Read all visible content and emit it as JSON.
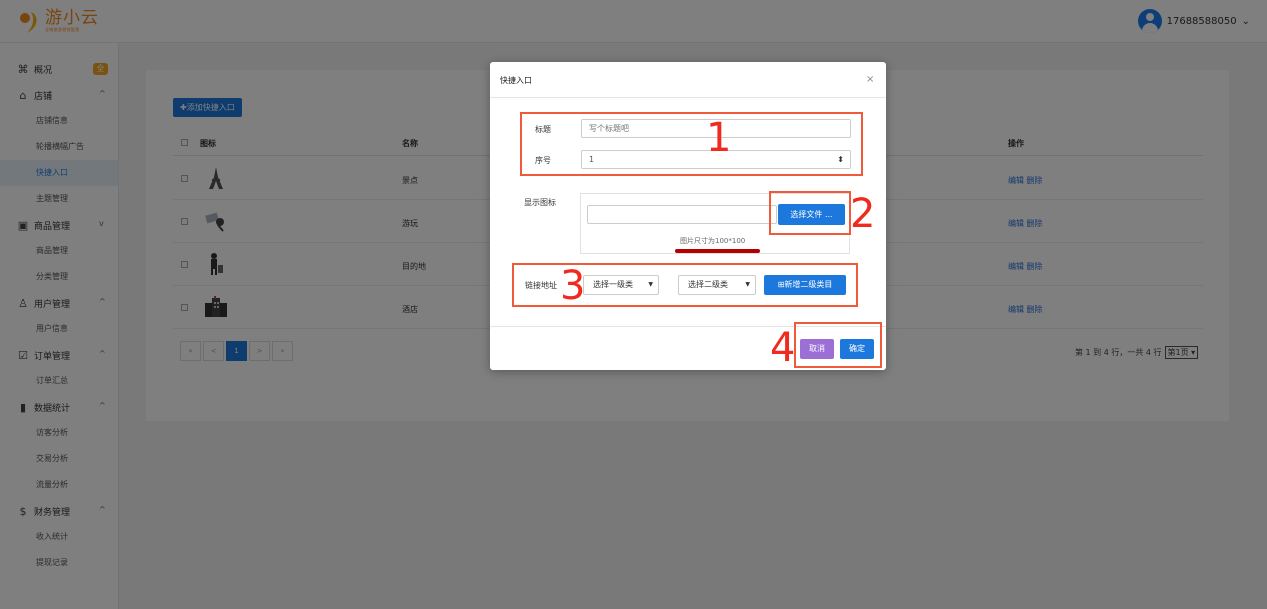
{
  "header": {
    "logo_name": "游小云",
    "logo_slogan": "全域旅游营销管理",
    "user_phone": "17688588050",
    "user_chevron": "⌄"
  },
  "sidebar": {
    "items": [
      {
        "type": "group",
        "label": "概况",
        "icon": "command-icon",
        "glyph": "⌘",
        "badge": "全"
      },
      {
        "type": "group",
        "label": "店铺",
        "icon": "home-icon",
        "glyph": "⌂",
        "chev": "^"
      },
      {
        "type": "sub",
        "label": "店铺信息"
      },
      {
        "type": "sub",
        "label": "轮播横幅广告"
      },
      {
        "type": "sub",
        "label": "快捷入口",
        "active": true
      },
      {
        "type": "sub",
        "label": "主题管理"
      },
      {
        "type": "group",
        "label": "商品管理",
        "icon": "calendar-icon",
        "glyph": "▣",
        "chev": "v"
      },
      {
        "type": "sub",
        "label": "商品管理"
      },
      {
        "type": "sub",
        "label": "分类管理"
      },
      {
        "type": "group",
        "label": "用户管理",
        "icon": "users-icon",
        "glyph": "♙",
        "chev": "^"
      },
      {
        "type": "sub",
        "label": "用户信息"
      },
      {
        "type": "group",
        "label": "订单管理",
        "icon": "checklist-icon",
        "glyph": "☑",
        "chev": "^"
      },
      {
        "type": "sub",
        "label": "订单汇总"
      },
      {
        "type": "group",
        "label": "数据统计",
        "icon": "bar-chart-icon",
        "glyph": "▮",
        "chev": "^"
      },
      {
        "type": "sub",
        "label": "访客分析"
      },
      {
        "type": "sub",
        "label": "交易分析"
      },
      {
        "type": "sub",
        "label": "流量分析"
      },
      {
        "type": "group",
        "label": "财务管理",
        "icon": "dollar-icon",
        "glyph": "$",
        "chev": "^"
      },
      {
        "type": "sub",
        "label": "收入统计"
      },
      {
        "type": "sub",
        "label": "提现记录"
      }
    ]
  },
  "main": {
    "add_button": "添加快捷入口",
    "columns": {
      "icon": "图标",
      "name": "名称",
      "ops": "操作"
    },
    "rows": [
      {
        "name": "景点",
        "ops": "编辑 删除",
        "icon": "tower-icon"
      },
      {
        "name": "游玩",
        "ops": "编辑 删除",
        "icon": "play-icon"
      },
      {
        "name": "目的地",
        "ops": "编辑 删除",
        "icon": "traveler-icon"
      },
      {
        "name": "酒店",
        "ops": "编辑 删除",
        "icon": "hotel-icon"
      }
    ],
    "pager": [
      "«",
      "<",
      "1",
      ">",
      "»"
    ],
    "page_info": "第 1 到 4 行，一共 4 行",
    "page_select": "第1页"
  },
  "modal": {
    "title": "快捷入口",
    "close": "×",
    "title_label": "标题",
    "title_placeholder": "写个标题吧",
    "order_label": "序号",
    "order_value": "1",
    "order_arrow": "⬍",
    "icon_label": "显示图标",
    "choose_file": "选择文件 ...",
    "size_hint": "图片尺寸为100*100",
    "link_label": "链接地址",
    "level1_select": "选择一级类",
    "level2_select": "选择二级类",
    "add_level2": "⊞新增二级类目",
    "cancel": "取消",
    "confirm": "确定"
  },
  "annotations": [
    "1",
    "2",
    "3",
    "4"
  ],
  "colors": {
    "accent": "#1c78dd",
    "brand": "#f08a1b",
    "annotation": "#f05a38",
    "cancel": "#9b6fd6"
  }
}
